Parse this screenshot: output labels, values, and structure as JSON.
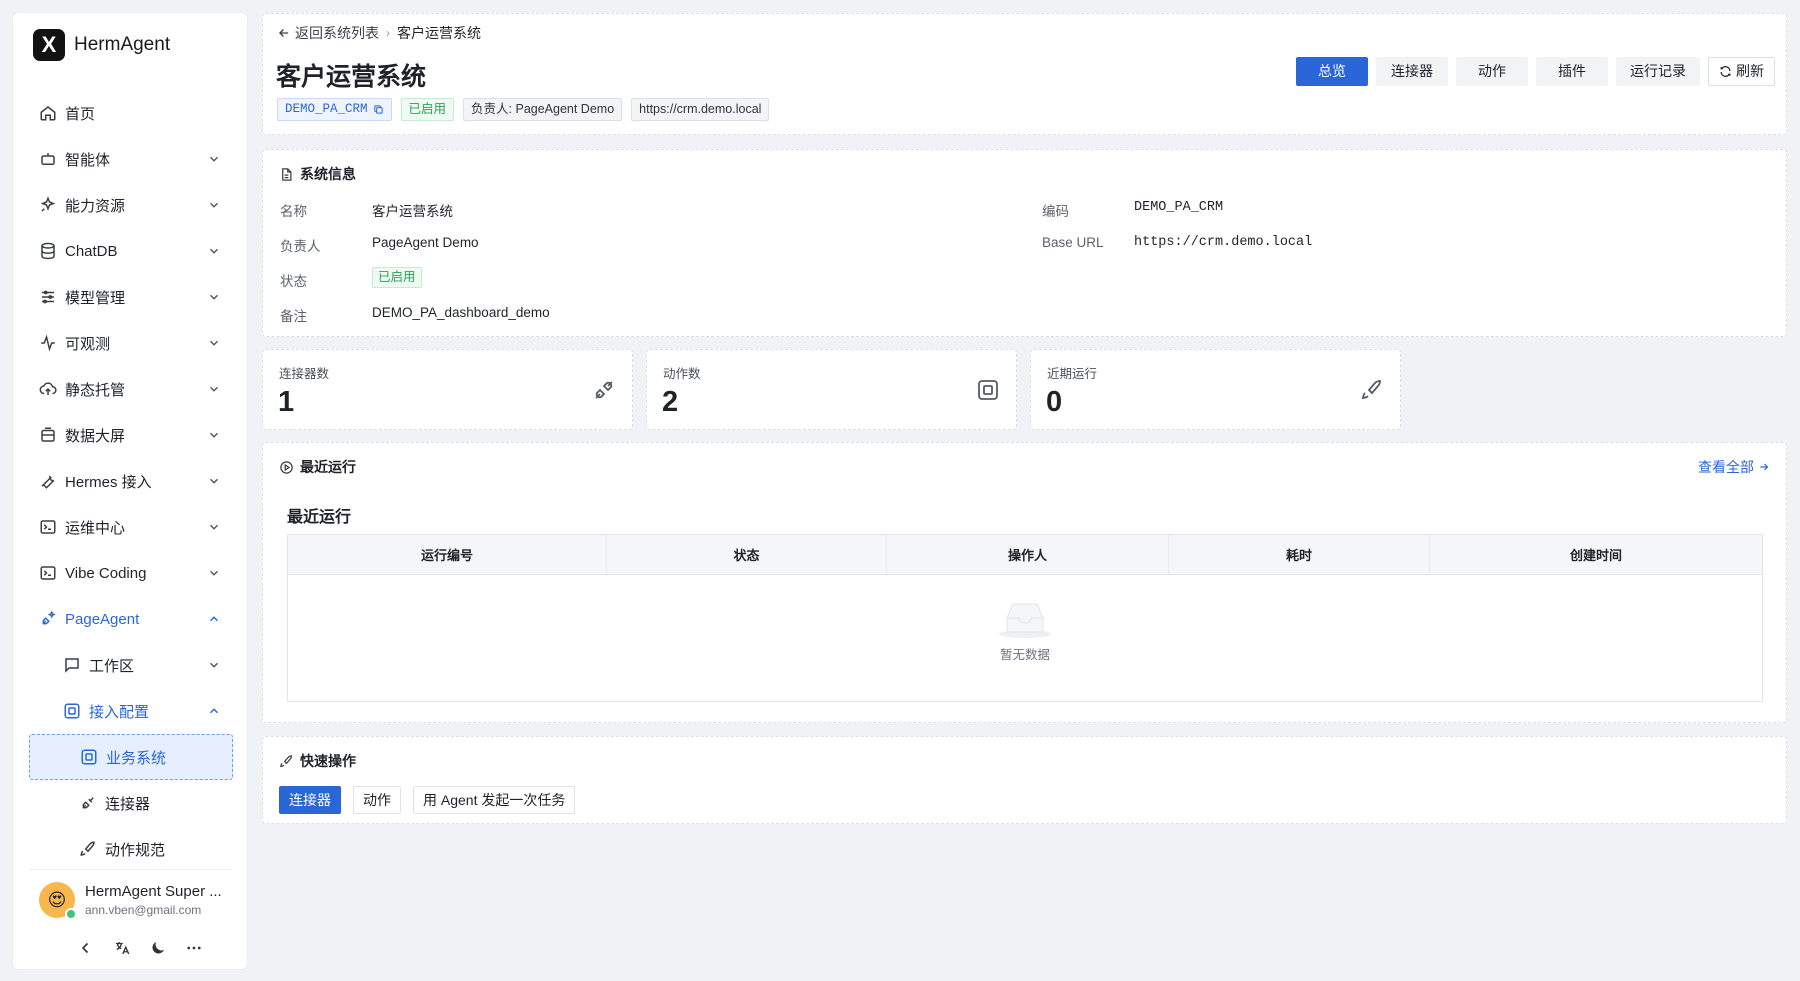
{
  "brand": {
    "logo_letter": "X",
    "name": "HermAgent"
  },
  "sidebar": {
    "items": [
      {
        "label": "首页",
        "icon": "home-icon"
      },
      {
        "label": "智能体",
        "icon": "robot-icon"
      },
      {
        "label": "能力资源",
        "icon": "sparkle-icon"
      },
      {
        "label": "ChatDB",
        "icon": "database-icon"
      },
      {
        "label": "模型管理",
        "icon": "sliders-icon"
      },
      {
        "label": "可观测",
        "icon": "pulse-icon"
      },
      {
        "label": "静态托管",
        "icon": "cloud-upload-icon"
      },
      {
        "label": "数据大屏",
        "icon": "monitor-icon"
      },
      {
        "label": "Hermes 接入",
        "icon": "wrench-icon"
      },
      {
        "label": "运维中心",
        "icon": "terminal-icon"
      },
      {
        "label": "Vibe Coding",
        "icon": "code-icon"
      },
      {
        "label": "PageAgent",
        "icon": "plug-sparkle-icon"
      },
      {
        "label": "工作区",
        "icon": "chat-icon"
      },
      {
        "label": "接入配置",
        "icon": "scan-icon"
      },
      {
        "label": "业务系统",
        "icon": "scan-icon"
      },
      {
        "label": "连接器",
        "icon": "plug-icon"
      },
      {
        "label": "动作规范",
        "icon": "rocket-icon"
      }
    ]
  },
  "user": {
    "name": "HermAgent Super ...",
    "email": "ann.vben@gmail.com",
    "avatar_emoji": "😍"
  },
  "header": {
    "back_label": "返回系统列表",
    "breadcrumb_current": "客户运营系统",
    "title": "客户运营系统",
    "tags": {
      "code": "DEMO_PA_CRM",
      "status": "已启用",
      "owner": "负责人: PageAgent Demo",
      "url": "https://crm.demo.local"
    },
    "buttons": {
      "overview": "总览",
      "connectors": "连接器",
      "actions": "动作",
      "plugins": "插件",
      "run_logs": "运行记录",
      "refresh": "刷新"
    }
  },
  "system_info": {
    "title": "系统信息",
    "name_label": "名称",
    "name_value": "客户运营系统",
    "owner_label": "负责人",
    "owner_value": "PageAgent Demo",
    "status_label": "状态",
    "status_value": "已启用",
    "remark_label": "备注",
    "remark_value": "DEMO_PA_dashboard_demo",
    "code_label": "编码",
    "code_value": "DEMO_PA_CRM",
    "url_label": "Base URL",
    "url_value": "https://crm.demo.local"
  },
  "stats": {
    "connectors": {
      "label": "连接器数",
      "value": "1"
    },
    "actions": {
      "label": "动作数",
      "value": "2"
    },
    "recent_runs": {
      "label": "近期运行",
      "value": "0"
    }
  },
  "recent_runs": {
    "section_title": "最近运行",
    "view_all": "查看全部",
    "table_title": "最近运行",
    "columns": [
      "运行编号",
      "状态",
      "操作人",
      "耗时",
      "创建时间"
    ],
    "rows": [],
    "empty_text": "暂无数据"
  },
  "quick_actions": {
    "title": "快速操作",
    "buttons": [
      "连接器",
      "动作",
      "用 Agent 发起一次任务"
    ]
  },
  "colors": {
    "primary": "#2b66d9",
    "success": "#2aa15b",
    "page_bg": "#f1f2f5"
  }
}
